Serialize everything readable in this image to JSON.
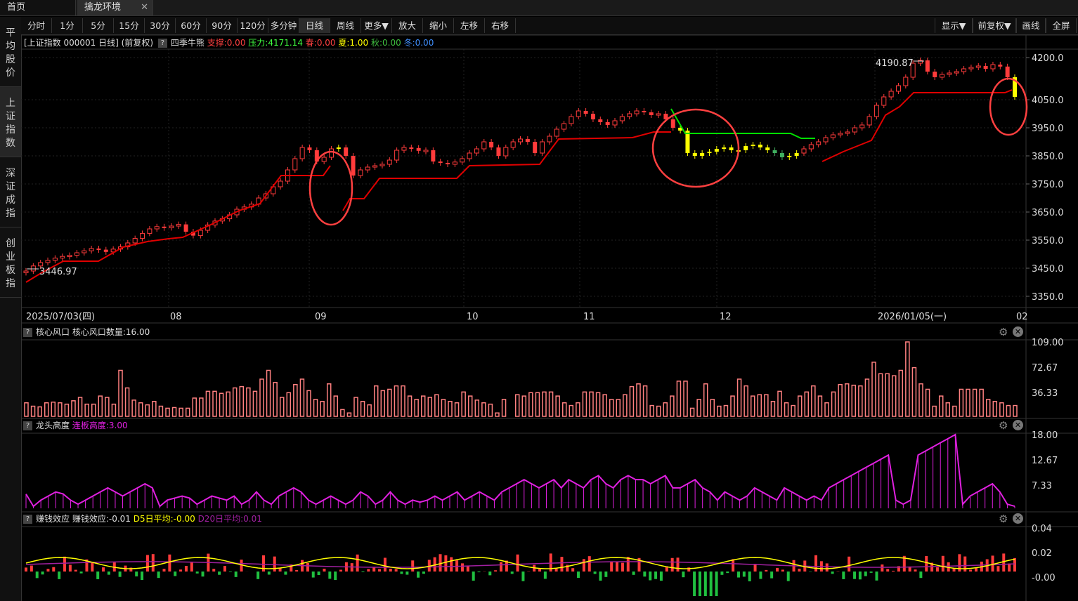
{
  "tabs": [
    {
      "label": "首页"
    },
    {
      "label": "擒龙环境"
    }
  ],
  "periods": [
    "分时",
    "1分",
    "5分",
    "15分",
    "30分",
    "60分",
    "90分",
    "120分",
    "多分钟",
    "日线",
    "周线",
    "更多▼",
    "放大",
    "缩小",
    "左移",
    "右移"
  ],
  "right_buttons": [
    "显示▼",
    "前复权▼",
    "画线",
    "全屏"
  ],
  "sidebar": [
    {
      "label": "平均股价"
    },
    {
      "label": "上证指数"
    },
    {
      "label": "深证成指"
    },
    {
      "label": "创业板指"
    }
  ],
  "main": {
    "title": "[上证指数 000001 日线]",
    "adj": "(前复权)",
    "indicator": "四季牛熊",
    "support": "支撑:0.00",
    "pressure": "压力:4171.14",
    "spring": "春:0.00",
    "summer": "夏:1.00",
    "autumn": "秋:0.00",
    "winter": "冬:0.00",
    "high_label": "4190.87",
    "low_label": "3446.97",
    "y_ticks": [
      "4200.0",
      "4050.0",
      "3950.0",
      "3850.0",
      "3750.0",
      "3650.0",
      "3550.0",
      "3450.0",
      "3350.0"
    ],
    "x_ticks": [
      "2025/07/03(四)",
      "08",
      "09",
      "10",
      "11",
      "12",
      "2026/01/05(一)",
      "02"
    ]
  },
  "p1": {
    "name": "核心风口",
    "value": "核心风口数量:16.00",
    "y_ticks": [
      "109.00",
      "72.67",
      "36.33"
    ]
  },
  "p2": {
    "name": "龙头高度",
    "value": "连板高度:3.00",
    "y_ticks": [
      "18.00",
      "12.67",
      "7.33"
    ]
  },
  "p3": {
    "name": "赚钱效应",
    "value": "赚钱效应:-0.01",
    "d5": "D5日平均:-0.00",
    "d20": "D20日平均:0.01",
    "y_ticks": [
      "0.04",
      "0.02",
      "-0.00"
    ]
  },
  "colors": {
    "up": "#ff3b3b",
    "down": "#20c040",
    "yellow": "#ffff00",
    "magenta": "#e020e0",
    "bar_pink": "#ff8080",
    "line_red": "#e00000",
    "green_line": "#00e000",
    "circle": "#ff4040"
  }
}
